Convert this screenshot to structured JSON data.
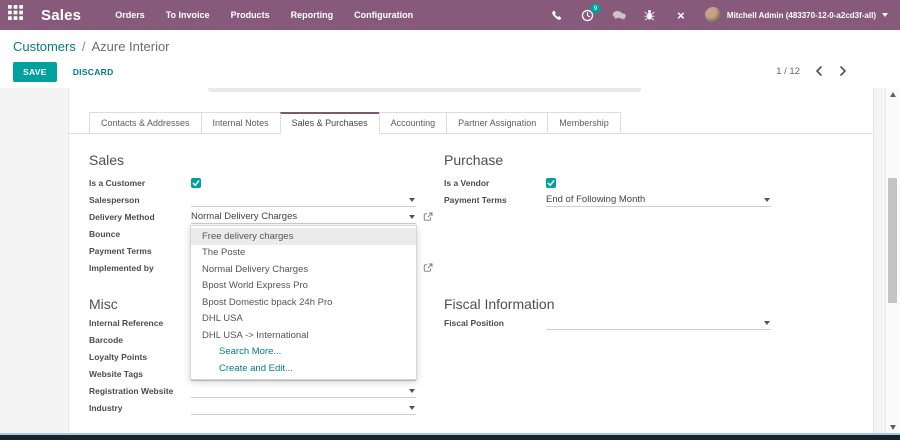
{
  "topbar": {
    "brand": "Sales",
    "menu": [
      {
        "label": "Orders"
      },
      {
        "label": "To Invoice"
      },
      {
        "label": "Products"
      },
      {
        "label": "Reporting"
      },
      {
        "label": "Configuration"
      }
    ],
    "activity_count": "9",
    "user_name": "Mitchell Admin (483370-12-0-a2cd3f-all)"
  },
  "control_panel": {
    "breadcrumb_parent": "Customers",
    "breadcrumb_separator": "/",
    "breadcrumb_current": "Azure Interior",
    "save_label": "SAVE",
    "discard_label": "DISCARD",
    "pager": "1 / 12"
  },
  "tabs": [
    {
      "label": "Contacts & Addresses",
      "active": false
    },
    {
      "label": "Internal Notes",
      "active": false
    },
    {
      "label": "Sales & Purchases",
      "active": true
    },
    {
      "label": "Accounting",
      "active": false
    },
    {
      "label": "Partner Assignation",
      "active": false
    },
    {
      "label": "Membership",
      "active": false
    }
  ],
  "form": {
    "sales": {
      "title": "Sales",
      "fields": [
        {
          "label": "Is a Customer",
          "type": "checkbox",
          "checked": true
        },
        {
          "label": "Salesperson",
          "type": "select",
          "value": ""
        },
        {
          "label": "Delivery Method",
          "type": "select",
          "value": "Normal Delivery Charges",
          "external_link": true,
          "open": true
        },
        {
          "label": "Bounce",
          "type": "input",
          "value": ""
        },
        {
          "label": "Payment Terms",
          "type": "select",
          "value": ""
        },
        {
          "label": "Implemented by",
          "type": "select",
          "value": "",
          "external_link": true
        }
      ]
    },
    "purchase": {
      "title": "Purchase",
      "fields": [
        {
          "label": "Is a Vendor",
          "type": "checkbox",
          "checked": true
        },
        {
          "label": "Payment Terms",
          "type": "select",
          "value": "End of Following Month"
        }
      ]
    },
    "misc": {
      "title": "Misc",
      "fields": [
        {
          "label": "Internal Reference",
          "type": "input",
          "value": ""
        },
        {
          "label": "Barcode",
          "type": "input",
          "value": ""
        },
        {
          "label": "Loyalty Points",
          "type": "input",
          "value": ""
        },
        {
          "label": "Website Tags",
          "type": "select",
          "value": ""
        },
        {
          "label": "Registration Website",
          "type": "select",
          "value": ""
        },
        {
          "label": "Industry",
          "type": "select",
          "value": ""
        }
      ]
    },
    "fiscal": {
      "title": "Fiscal Information",
      "fields": [
        {
          "label": "Fiscal Position",
          "type": "select",
          "value": ""
        }
      ]
    }
  },
  "dropdown": {
    "field": "Delivery Method",
    "items": [
      {
        "label": "Free delivery charges",
        "highlighted": true
      },
      {
        "label": "The Poste",
        "highlighted": false
      },
      {
        "label": "Normal Delivery Charges",
        "highlighted": false
      },
      {
        "label": "Bpost World Express Pro",
        "highlighted": false
      },
      {
        "label": "Bpost Domestic bpack 24h Pro",
        "highlighted": false
      },
      {
        "label": "DHL USA",
        "highlighted": false
      },
      {
        "label": "DHL USA -> International",
        "highlighted": false
      }
    ],
    "search_more": "Search More...",
    "create_edit": "Create and Edit..."
  },
  "colors": {
    "topbar_purple": "#875A7B",
    "accent_teal": "#00A09D",
    "link_teal": "#017E84",
    "active_tab_border": "#7C5A6D",
    "dropdown_highlight": "#EBEBEB"
  }
}
